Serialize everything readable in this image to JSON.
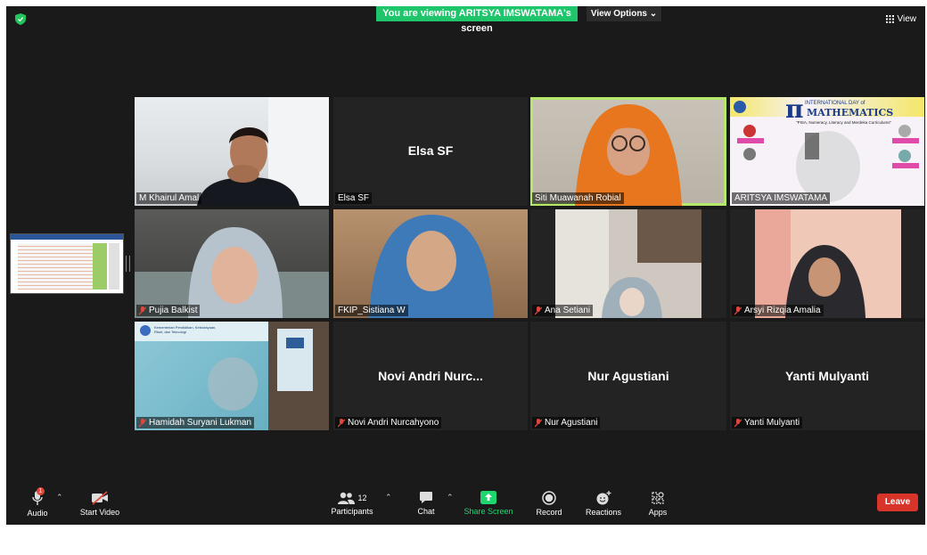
{
  "top": {
    "share_banner": "You are viewing ARITSYA IMSWATAMA's screen",
    "view_options": "View Options",
    "view": "View"
  },
  "tiles": [
    {
      "name": "M Khairul Amal",
      "big": ""
    },
    {
      "name": "Elsa SF",
      "big": "Elsa SF"
    },
    {
      "name": "Siti Muawanah Robial",
      "big": ""
    },
    {
      "name": "ARITSYA IMSWATAMA",
      "big": ""
    },
    {
      "name": "Pujia Balkist",
      "big": ""
    },
    {
      "name": "FKIP_Sistiana W",
      "big": ""
    },
    {
      "name": "Ana Setiani",
      "big": ""
    },
    {
      "name": "Arsyi Rizqia Amalia",
      "big": ""
    },
    {
      "name": "Hamidah Suryani Lukman",
      "big": ""
    },
    {
      "name": "Novi Andri Nurcahyono",
      "big": "Novi Andri Nurc..."
    },
    {
      "name": "Nur Agustiani",
      "big": "Nur Agustiani"
    },
    {
      "name": "Yanti Mulyanti",
      "big": "Yanti Mulyanti"
    }
  ],
  "poster": {
    "title1": "INTERNATIONAL DAY of",
    "title2": "MATHEMATICS",
    "subtitle": "\"PISA, Numeracy, Literacy and Merdeka Curriculums\"",
    "unit": "Kementerian Pendidikan, Kebudayaan, Riset, dan Teknologi"
  },
  "toolbar": {
    "audio": "Audio",
    "start_video": "Start Video",
    "participants": "Participants",
    "participants_count": "12",
    "chat": "Chat",
    "share_screen": "Share Screen",
    "record": "Record",
    "reactions": "Reactions",
    "apps": "Apps",
    "leave": "Leave",
    "audio_badge": "1"
  },
  "colors": {
    "share_banner": "#1fc56b",
    "active_speaker": "#b6e86b",
    "leave": "#d8342a",
    "background": "#1a1a1a"
  }
}
